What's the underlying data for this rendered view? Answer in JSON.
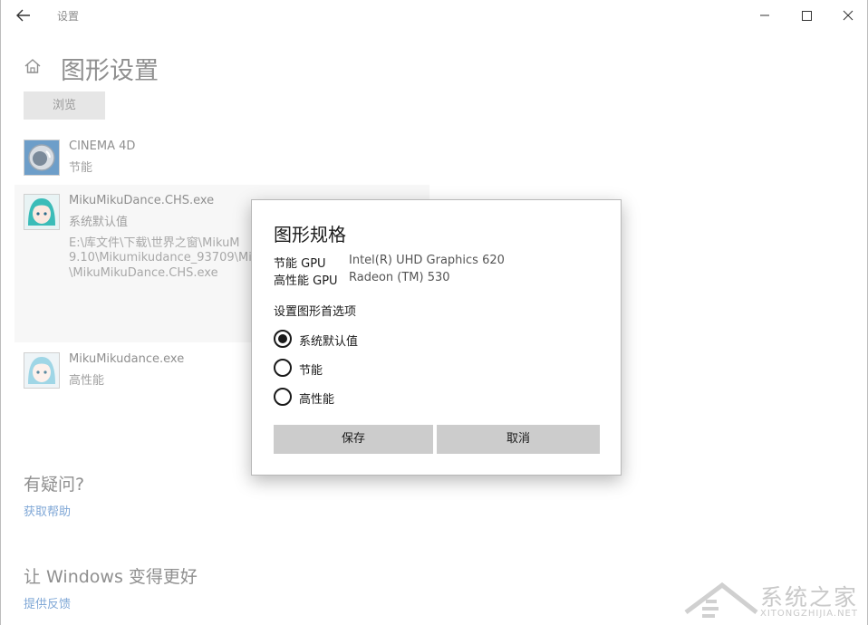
{
  "window": {
    "title": "设置",
    "controls": [
      "minimize-icon",
      "maximize-icon",
      "close-icon"
    ]
  },
  "page": {
    "title": "图形设置",
    "browse_label": "浏览"
  },
  "apps": [
    {
      "name": "CINEMA 4D",
      "mode": "节能",
      "icon": "cinema4d-app-icon"
    },
    {
      "name": "MikuMikuDance.CHS.exe",
      "mode": "系统默认值",
      "icon": "mmd-app-icon",
      "path": [
        "E:\\库文件\\下载\\世界之窗\\MikuM",
        "9.10\\Mikumikudance_93709\\Mik",
        "\\MikuMikuDance.CHS.exe"
      ]
    },
    {
      "name": "MikuMikudance.exe",
      "mode": "高性能",
      "icon": "mmd-app-icon"
    }
  ],
  "help": {
    "heading": "有疑问?",
    "link": "获取帮助"
  },
  "feedback": {
    "heading": "让 Windows 变得更好",
    "link": "提供反馈"
  },
  "dialog": {
    "title": "图形规格",
    "power_saving_gpu_label": "节能 GPU",
    "power_saving_gpu_value": "Intel(R) UHD Graphics 620",
    "high_perf_gpu_label": "高性能 GPU",
    "high_perf_gpu_value": "Radeon (TM) 530",
    "pref_label": "设置图形首选项",
    "options": [
      "系统默认值",
      "节能",
      "高性能"
    ],
    "selected": "系统默认值",
    "save_label": "保存",
    "cancel_label": "取消"
  },
  "watermark": {
    "text": "系统之家",
    "sub": "XITONGZHIJIA.NET"
  },
  "colors": {
    "link": "#7fa7d6",
    "dialog_button": "#cccccc",
    "dim_text": "#8f8f8f"
  }
}
